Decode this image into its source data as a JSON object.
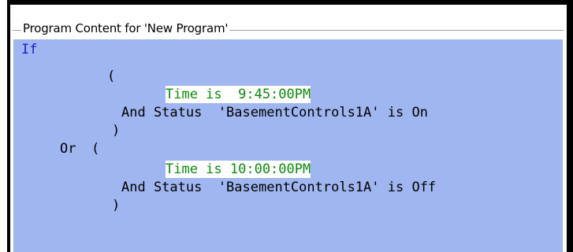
{
  "panel": {
    "title": "Program Content for 'New Program'"
  },
  "code": {
    "if_keyword": "If",
    "open_paren_1": "(",
    "cond1_text": "Time is  9:45:00PM",
    "and1_text": "And Status  'BasementControls1A' is On",
    "close_paren_1": ")",
    "or_keyword": "Or",
    "open_paren_2": "(",
    "cond2_text": "Time is 10:00:00PM",
    "and2_text": "And Status  'BasementControls1A' is Off",
    "close_paren_2": ")"
  },
  "colors": {
    "code_background": "#a0b6f0",
    "keyword_blue": "#1a1acc",
    "condition_green": "#0a8a0a"
  }
}
